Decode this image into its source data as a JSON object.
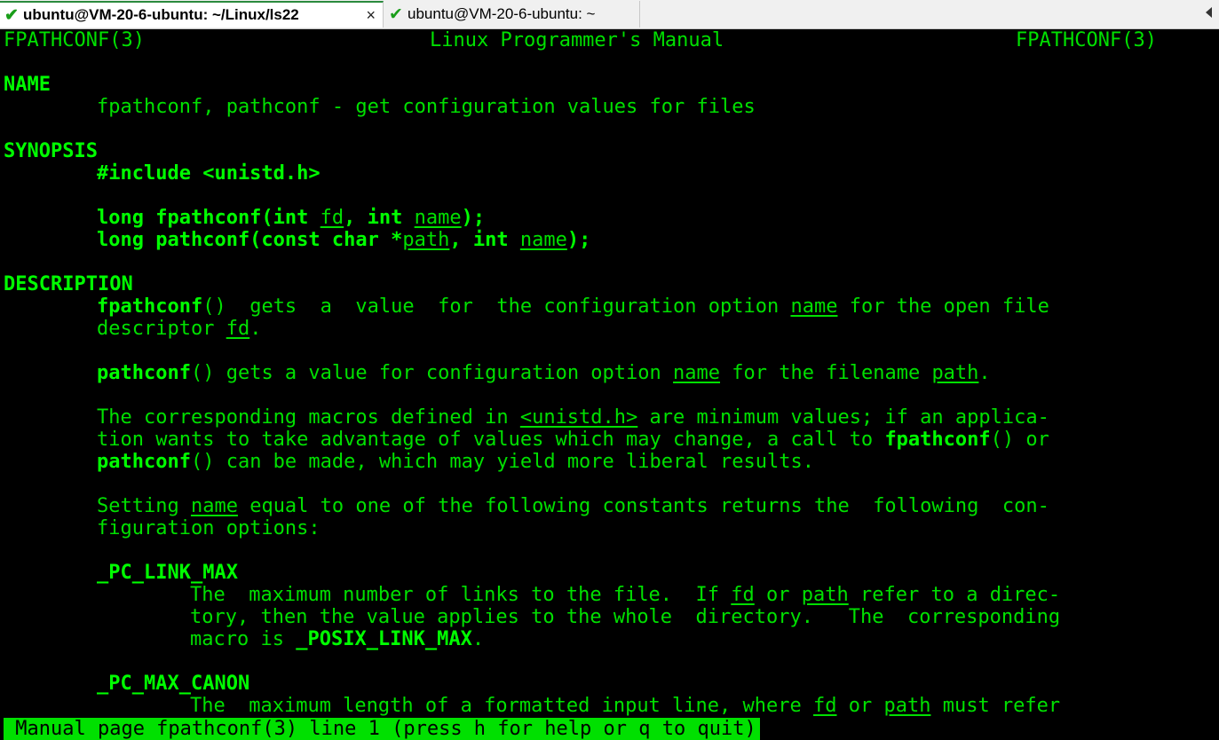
{
  "tabs": [
    {
      "label": "ubuntu@VM-20-6-ubuntu: ~/Linux/ls22",
      "active": true,
      "close": "×"
    },
    {
      "label": "ubuntu@VM-20-6-ubuntu: ~",
      "active": false
    }
  ],
  "header": {
    "left": "FPATHCONF(3)",
    "center": "Linux Programmer's Manual",
    "right": "FPATHCONF(3)"
  },
  "name_section": {
    "heading": "NAME",
    "text": "fpathconf, pathconf - get configuration values for files"
  },
  "synopsis": {
    "heading": "SYNOPSIS",
    "include": "#include <unistd.h>",
    "proto1": {
      "a": "long fpathconf(int ",
      "fd": "fd",
      "b": ", int ",
      "name": "name",
      "c": ");"
    },
    "proto2": {
      "a": "long pathconf(const char *",
      "path": "path",
      "b": ", int ",
      "name": "name",
      "c": ");"
    }
  },
  "description": {
    "heading": "DESCRIPTION",
    "p1": {
      "fn": "fpathconf",
      "a": "()  gets  a  value  for  the configuration option ",
      "name": "name",
      "b": " for the open file",
      "l2a": "descriptor ",
      "fd": "fd",
      "l2b": "."
    },
    "p2": {
      "fn": "pathconf",
      "a": "() gets a value for configuration option ",
      "name": "name",
      "b": " for the filename ",
      "path": "path",
      "c": "."
    },
    "p3": {
      "a": "The corresponding macros defined in ",
      "hdr": "<unistd.h>",
      "b": " are minimum values; if an applica‐",
      "l2a": "tion wants to take advantage of values which may change, a call to ",
      "fn1": "fpathconf",
      "l2b": "() or",
      "fn2": "pathconf",
      "l3": "() can be made, which may yield more liberal results."
    },
    "p4": {
      "a": "Setting ",
      "name": "name",
      "b": " equal to one of the following constants returns the  following  con‐",
      "l2": "figuration options:"
    },
    "link_max": {
      "const": "_PC_LINK_MAX",
      "l1a": "The  maximum number of links to the file.  If ",
      "fd": "fd",
      "l1b": " or ",
      "path": "path",
      "l1c": " refer to a direc‐",
      "l2": "tory, then the value applies to the whole  directory.   The  corresponding",
      "l3a": "macro is ",
      "macro": "_POSIX_LINK_MAX",
      "l3b": "."
    },
    "max_canon": {
      "const": "_PC_MAX_CANON",
      "l1a": "The  maximum length of a formatted input line, where ",
      "fd": "fd",
      "l1b": " or ",
      "path": "path",
      "l1c": " must refer"
    }
  },
  "status_bar": " Manual page fpathconf(3) line 1 (press h for help or q to quit)"
}
